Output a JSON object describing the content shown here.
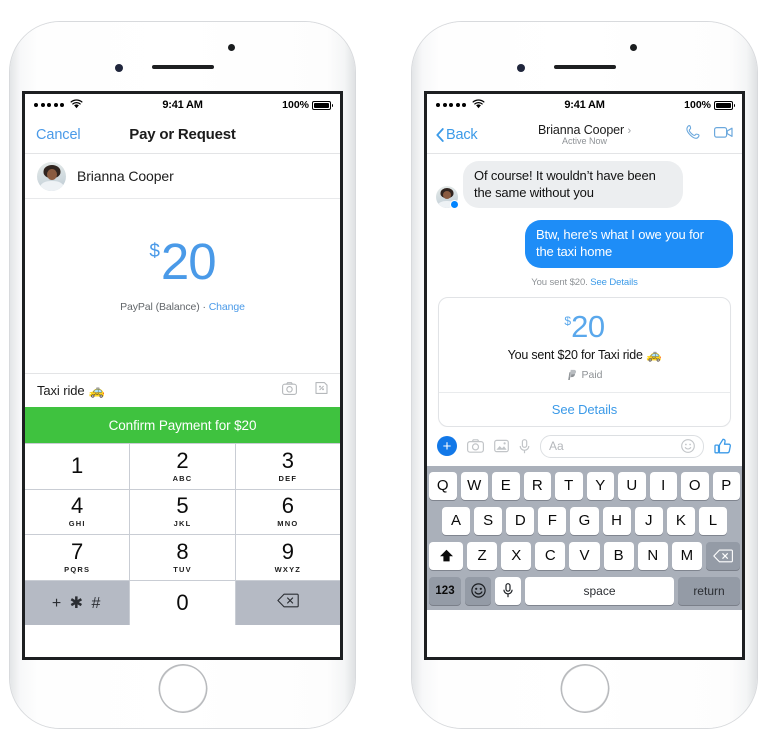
{
  "left_phone": {
    "status_bar": {
      "carrier_dots": 5,
      "wifi_icon": "wifi-icon",
      "time": "9:41 AM",
      "battery_percent": "100%"
    },
    "navbar": {
      "cancel_label": "Cancel",
      "title": "Pay or Request"
    },
    "contact": {
      "name": "Brianna Cooper",
      "avatar_icon": "avatar"
    },
    "amount": {
      "currency_symbol": "$",
      "value": "20"
    },
    "funding": {
      "source": "PayPal (Balance)",
      "separator": "·",
      "change_label": "Change"
    },
    "memo": {
      "value": "Taxi ride",
      "emoji": "🚕",
      "camera_icon": "camera-icon",
      "sticker_icon": "sticker-icon"
    },
    "confirm": {
      "label": "Confirm Payment for $20",
      "color": "#3fc23f"
    },
    "keypad": [
      {
        "digit": "1",
        "letters": ""
      },
      {
        "digit": "2",
        "letters": "ABC"
      },
      {
        "digit": "3",
        "letters": "DEF"
      },
      {
        "digit": "4",
        "letters": "GHI"
      },
      {
        "digit": "5",
        "letters": "JKL"
      },
      {
        "digit": "6",
        "letters": "MNO"
      },
      {
        "digit": "7",
        "letters": "PQRS"
      },
      {
        "digit": "8",
        "letters": "TUV"
      },
      {
        "digit": "9",
        "letters": "WXYZ"
      },
      {
        "digit": "+ ✱ #",
        "letters": ""
      },
      {
        "digit": "0",
        "letters": ""
      },
      {
        "digit": "delete-icon",
        "letters": ""
      }
    ]
  },
  "right_phone": {
    "status_bar": {
      "carrier_dots": 5,
      "wifi_icon": "wifi-icon",
      "time": "9:41 AM",
      "battery_percent": "100%"
    },
    "navbar": {
      "back_label": "Back",
      "title": "Brianna Cooper",
      "title_chevron": "›",
      "subtitle": "Active Now",
      "call_icon": "phone-call-icon",
      "video_icon": "video-call-icon"
    },
    "messages": [
      {
        "direction": "incoming",
        "text": "Of course! It wouldn’t have been the same without you"
      },
      {
        "direction": "outgoing",
        "text": "Btw, here's what I owe you for the taxi home"
      }
    ],
    "sent_note": {
      "text": "You sent $20.",
      "link": "See Details"
    },
    "payment_card": {
      "currency_symbol": "$",
      "amount": "20",
      "description": "You sent $20 for Taxi ride",
      "description_emoji": "🚕",
      "status": "Paid",
      "status_icon": "paypal-icon",
      "details_label": "See Details"
    },
    "composer": {
      "plus_label": "+",
      "plus_icon": "plus-circle-icon",
      "camera_icon": "camera-icon",
      "gallery_icon": "photo-gallery-icon",
      "mic_icon": "microphone-icon",
      "input_placeholder": "Aa",
      "emoji_icon": "emoji-smiley-icon",
      "thumb_icon": "thumbs-up-icon"
    },
    "keyboard": {
      "row1": [
        "Q",
        "W",
        "E",
        "R",
        "T",
        "Y",
        "U",
        "I",
        "O",
        "P"
      ],
      "row2": [
        "A",
        "S",
        "D",
        "F",
        "G",
        "H",
        "J",
        "K",
        "L"
      ],
      "row3_shift_icon": "shift-icon",
      "row3": [
        "Z",
        "X",
        "C",
        "V",
        "B",
        "N",
        "M"
      ],
      "row3_delete_icon": "delete-icon",
      "numbers_key": "123",
      "emoji_key_icon": "emoji-smiley-icon",
      "mic_key_icon": "microphone-icon",
      "space_key": "space",
      "return_key": "return"
    }
  }
}
